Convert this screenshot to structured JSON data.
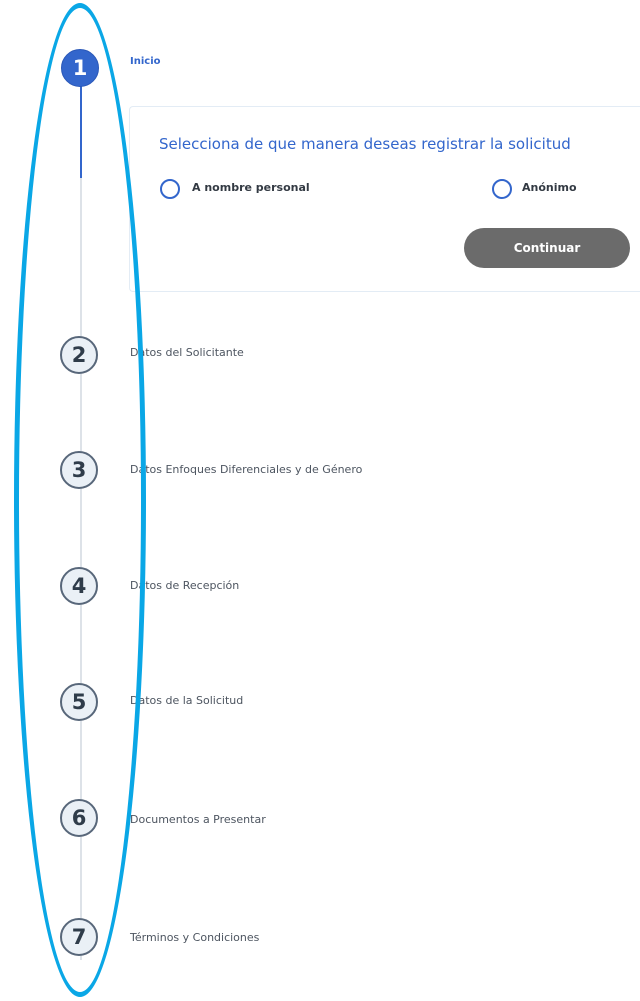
{
  "stepper": {
    "steps": [
      {
        "number": "1",
        "label": "Inicio",
        "active": true
      },
      {
        "number": "2",
        "label": "Datos del Solicitante",
        "active": false
      },
      {
        "number": "3",
        "label": "Datos Enfoques Diferenciales y de Género",
        "active": false
      },
      {
        "number": "4",
        "label": "Datos de Recepción",
        "active": false
      },
      {
        "number": "5",
        "label": "Datos de la Solicitud",
        "active": false
      },
      {
        "number": "6",
        "label": "Documentos a Presentar",
        "active": false
      },
      {
        "number": "7",
        "label": "Términos y Condiciones",
        "active": false
      }
    ]
  },
  "form": {
    "title": "Selecciona de que manera deseas registrar la solicitud",
    "options": [
      {
        "label": "A nombre personal",
        "selected": false
      },
      {
        "label": "Anónimo",
        "selected": false
      }
    ],
    "continue_label": "Continuar"
  },
  "colors": {
    "accent": "#3366cc",
    "button_bg": "#6b6b6b",
    "annotation": "#0aa7e6",
    "step_border": "#58677a"
  }
}
